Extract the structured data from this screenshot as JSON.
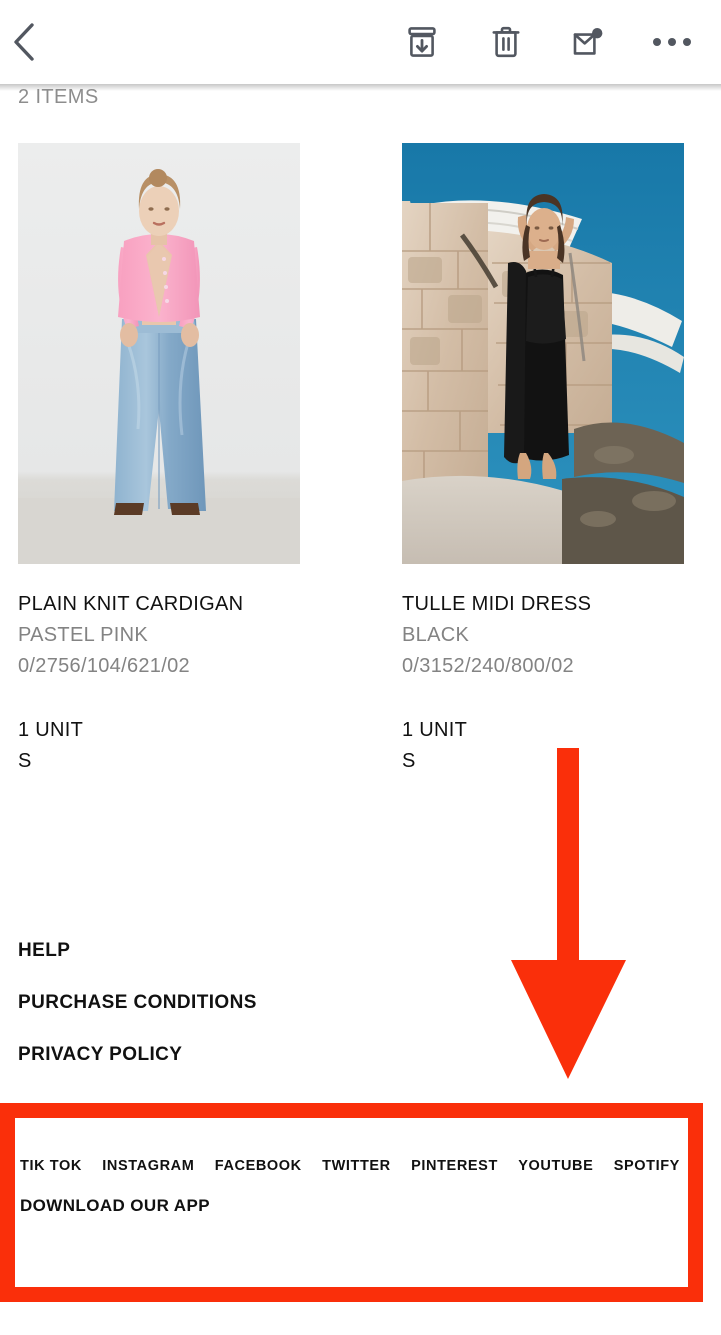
{
  "appbar": {
    "back_label": "Back",
    "icons": [
      {
        "name": "archive-icon",
        "label": "Archive"
      },
      {
        "name": "delete-icon",
        "label": "Delete"
      },
      {
        "name": "mark-unread-icon",
        "label": "Mark as unread"
      },
      {
        "name": "more-options-icon",
        "label": "More options"
      }
    ]
  },
  "order": {
    "items_count_label": "2 ITEMS",
    "products": [
      {
        "name": "PLAIN KNIT CARDIGAN",
        "color": "PASTEL PINK",
        "reference": "0/2756/104/621/02",
        "units": "1 UNIT",
        "size": "S",
        "photo_alt": "model wearing pink knit cardigan and blue jeans"
      },
      {
        "name": "TULLE MIDI DRESS",
        "color": "BLACK",
        "reference": "0/3152/240/800/02",
        "units": "1 UNIT",
        "size": "S",
        "photo_alt": "model wearing black midi dress beside stone wall and boats"
      }
    ]
  },
  "policy_links": [
    "HELP",
    "PURCHASE CONDITIONS",
    "PRIVACY POLICY"
  ],
  "footer": {
    "social_links": [
      "TIK TOK",
      "INSTAGRAM",
      "FACEBOOK",
      "TWITTER",
      "PINTEREST",
      "YOUTUBE",
      "SPOTIFY"
    ],
    "download_app_label": "DOWNLOAD OUR APP"
  },
  "annotations": {
    "highlight_color": "#fa2f0a",
    "arrow_color": "#fa2f0a",
    "arrow_direction": "down",
    "target": "DOWNLOAD OUR APP"
  }
}
